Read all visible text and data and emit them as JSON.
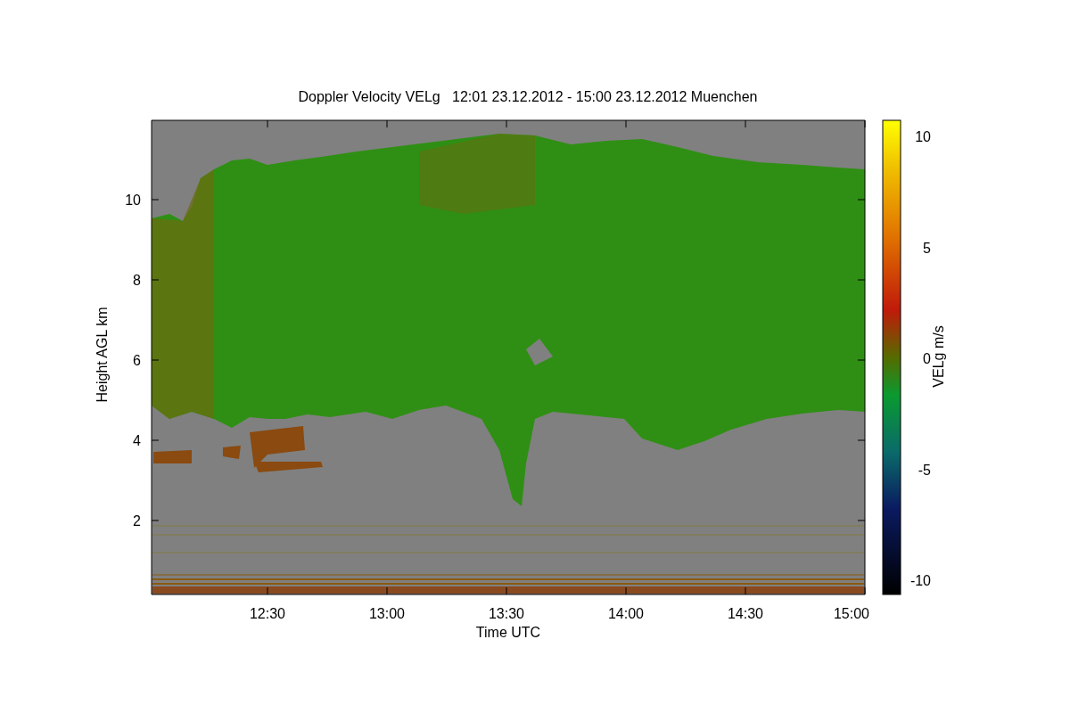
{
  "title": "Doppler Velocity VELg   12:01 23.12.2012 - 15:00 23.12.2012 Muenchen",
  "x_axis": {
    "label": "Time UTC",
    "ticks": [
      "12:30",
      "13:00",
      "13:30",
      "14:00",
      "14:30",
      "15:00"
    ]
  },
  "y_axis": {
    "label": "Height AGL km",
    "ticks": [
      "10",
      "8",
      "6",
      "4",
      "2"
    ]
  },
  "colorbar": {
    "label": "VELg m/s",
    "ticks": [
      "10",
      "5",
      "0",
      "-5",
      "-10"
    ]
  }
}
